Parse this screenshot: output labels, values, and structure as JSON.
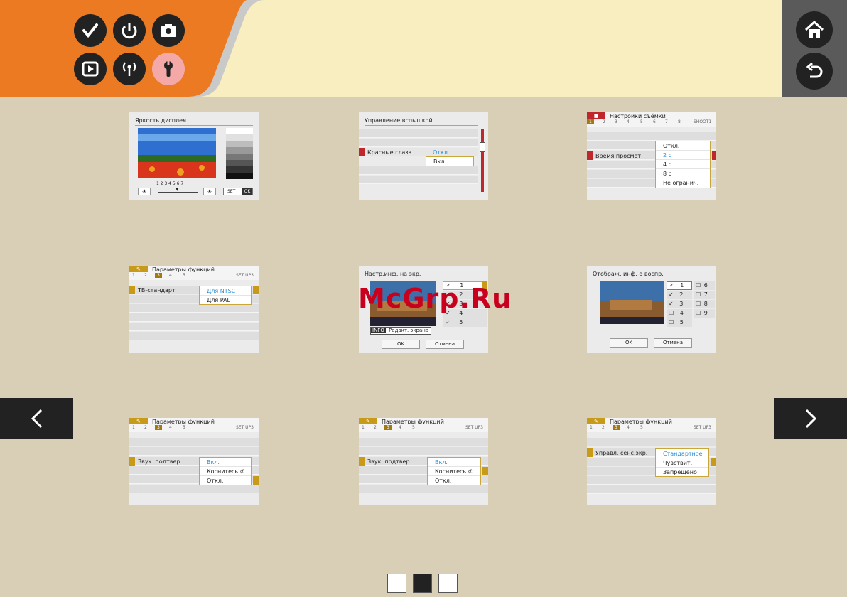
{
  "nav": {
    "icons": [
      "check-icon",
      "power-icon",
      "camera-icon",
      "playback-icon",
      "wireless-icon",
      "wrench-icon"
    ],
    "active": "wrench-icon"
  },
  "screens": {
    "s1": {
      "title": "Яркость дисплея",
      "scale": "1 2 3 4 5 6 7",
      "set": "SET",
      "ok": "OK"
    },
    "s2": {
      "title": "Управление вспышкой",
      "row": "Красные глаза",
      "current": "Откл.",
      "option": "Вкл."
    },
    "s3": {
      "title": "Настройки съёмки",
      "tabs": [
        "1",
        "2",
        "3",
        "4",
        "5",
        "6",
        "7",
        "8",
        "SHOOT1"
      ],
      "row": "Время просмот.",
      "options": [
        "Откл.",
        "2 с",
        "4 с",
        "8 с",
        "Не огранич."
      ]
    },
    "s4": {
      "title": "Параметры функций",
      "tabs": [
        "1",
        "2",
        "3",
        "4",
        "5",
        "SET UP3"
      ],
      "row": "ТВ-стандарт",
      "options": [
        "Для NTSC",
        "Для PAL"
      ]
    },
    "s5": {
      "title": "Настр.инф. на экр.",
      "checks": [
        "1",
        "2",
        "3",
        "4",
        "5"
      ],
      "info": "INFO",
      "edit": "Редакт. экрана",
      "ok": "OK",
      "cancel": "Отмена"
    },
    "s6": {
      "title": "Отображ. инф. о воспр.",
      "left": [
        "1",
        "2",
        "3",
        "4",
        "5"
      ],
      "right": [
        "6",
        "7",
        "8",
        "9"
      ],
      "ok": "OK",
      "cancel": "Отмена"
    },
    "s7": {
      "title": "Параметры функций",
      "tabs": [
        "1",
        "2",
        "3",
        "4",
        "5",
        "SET UP3"
      ],
      "row": "Звук. подтвер.",
      "options": [
        "Вкл.",
        "Коснитесь ⊄",
        "Откл."
      ]
    },
    "s8": {
      "title": "Параметры функций",
      "tabs": [
        "1",
        "2",
        "3",
        "4",
        "5",
        "SET UP3"
      ],
      "row": "Звук. подтвер.",
      "options": [
        "Вкл.",
        "Коснитесь ⊄",
        "Откл."
      ]
    },
    "s9": {
      "title": "Параметры функций",
      "tabs": [
        "1",
        "2",
        "3",
        "4",
        "5",
        "SET UP3"
      ],
      "row": "Управл. сенс.экр.",
      "options": [
        "Стандартное",
        "Чувствит.",
        "Запрещено"
      ]
    }
  },
  "watermark": "McGrp.Ru"
}
